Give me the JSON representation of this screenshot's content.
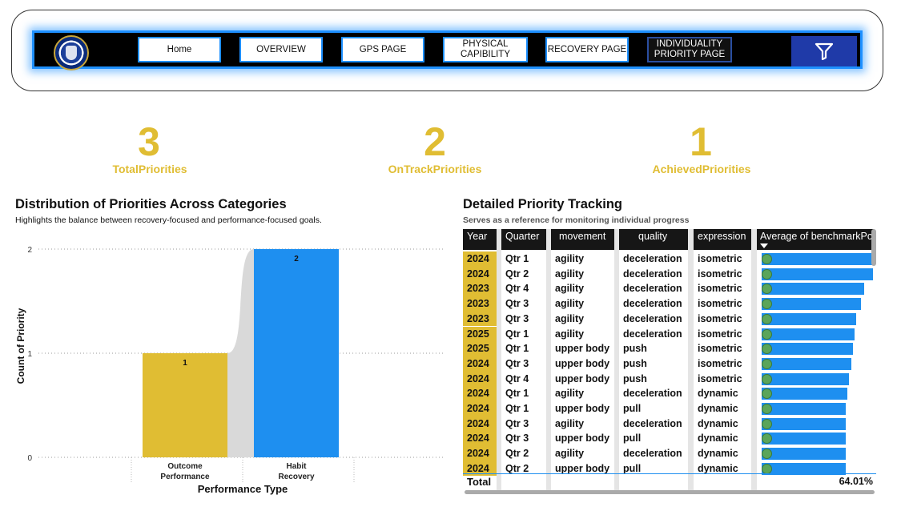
{
  "nav": {
    "buttons": [
      "Home",
      "OVERVIEW",
      "GPS PAGE",
      "PHYSICAL\nCAPIBILITY",
      "RECOVERY PAGE",
      "INDIVIDUALITY\nPRIORITY PAGE"
    ],
    "active_index": 5
  },
  "kpis": [
    {
      "value": "3",
      "label": "TotalPriorities"
    },
    {
      "value": "2",
      "label": "OnTrackPriorities"
    },
    {
      "value": "1",
      "label": "AchievedPriorities"
    }
  ],
  "chart": {
    "title": "Distribution of Priorities Across Categories",
    "subtitle": "Highlights the balance between recovery-focused and performance-focused goals."
  },
  "chart_data": {
    "type": "bar",
    "categories": [
      "Outcome\nPerformance",
      "Habit\nRecovery"
    ],
    "values": [
      1,
      2
    ],
    "colors": [
      "#e0bd33",
      "#1e8ff0"
    ],
    "xlabel": "Performance Type",
    "ylabel": "Count of Priority",
    "ylim": [
      0,
      2
    ],
    "yticks": [
      0,
      1,
      2
    ],
    "grid": true
  },
  "table": {
    "title": "Detailed Priority Tracking",
    "subtitle": "Serves as a reference for monitoring individual progress",
    "headers": [
      "Year",
      "Quarter",
      "movement",
      "quality",
      "expression",
      "Average of benchmarkPct"
    ],
    "rows": [
      {
        "year": "2024",
        "quarter": "Qtr 1",
        "movement": "agility",
        "quality": "deceleration",
        "expression": "isometric",
        "pct": 0.99
      },
      {
        "year": "2024",
        "quarter": "Qtr 2",
        "movement": "agility",
        "quality": "deceleration",
        "expression": "isometric",
        "pct": 0.98
      },
      {
        "year": "2023",
        "quarter": "Qtr 4",
        "movement": "agility",
        "quality": "deceleration",
        "expression": "isometric",
        "pct": 0.9
      },
      {
        "year": "2023",
        "quarter": "Qtr 3",
        "movement": "agility",
        "quality": "deceleration",
        "expression": "isometric",
        "pct": 0.87
      },
      {
        "year": "2023",
        "quarter": "Qtr 3",
        "movement": "agility",
        "quality": "deceleration",
        "expression": "isometric",
        "pct": 0.83
      },
      {
        "year": "2025",
        "quarter": "Qtr 1",
        "movement": "agility",
        "quality": "deceleration",
        "expression": "isometric",
        "pct": 0.82
      },
      {
        "year": "2025",
        "quarter": "Qtr 1",
        "movement": "upper body",
        "quality": "push",
        "expression": "isometric",
        "pct": 0.8
      },
      {
        "year": "2024",
        "quarter": "Qtr 3",
        "movement": "upper body",
        "quality": "push",
        "expression": "isometric",
        "pct": 0.79
      },
      {
        "year": "2024",
        "quarter": "Qtr 4",
        "movement": "upper body",
        "quality": "push",
        "expression": "isometric",
        "pct": 0.77
      },
      {
        "year": "2024",
        "quarter": "Qtr 1",
        "movement": "agility",
        "quality": "deceleration",
        "expression": "dynamic",
        "pct": 0.75
      },
      {
        "year": "2024",
        "quarter": "Qtr 1",
        "movement": "upper body",
        "quality": "pull",
        "expression": "dynamic",
        "pct": 0.74
      },
      {
        "year": "2024",
        "quarter": "Qtr 3",
        "movement": "agility",
        "quality": "deceleration",
        "expression": "dynamic",
        "pct": 0.74
      },
      {
        "year": "2024",
        "quarter": "Qtr 3",
        "movement": "upper body",
        "quality": "pull",
        "expression": "dynamic",
        "pct": 0.74
      },
      {
        "year": "2024",
        "quarter": "Qtr 2",
        "movement": "agility",
        "quality": "deceleration",
        "expression": "dynamic",
        "pct": 0.74
      },
      {
        "year": "2024",
        "quarter": "Qtr 2",
        "movement": "upper body",
        "quality": "pull",
        "expression": "dynamic",
        "pct": 0.74
      }
    ],
    "total_label": "Total",
    "total_value": "64.01%"
  }
}
